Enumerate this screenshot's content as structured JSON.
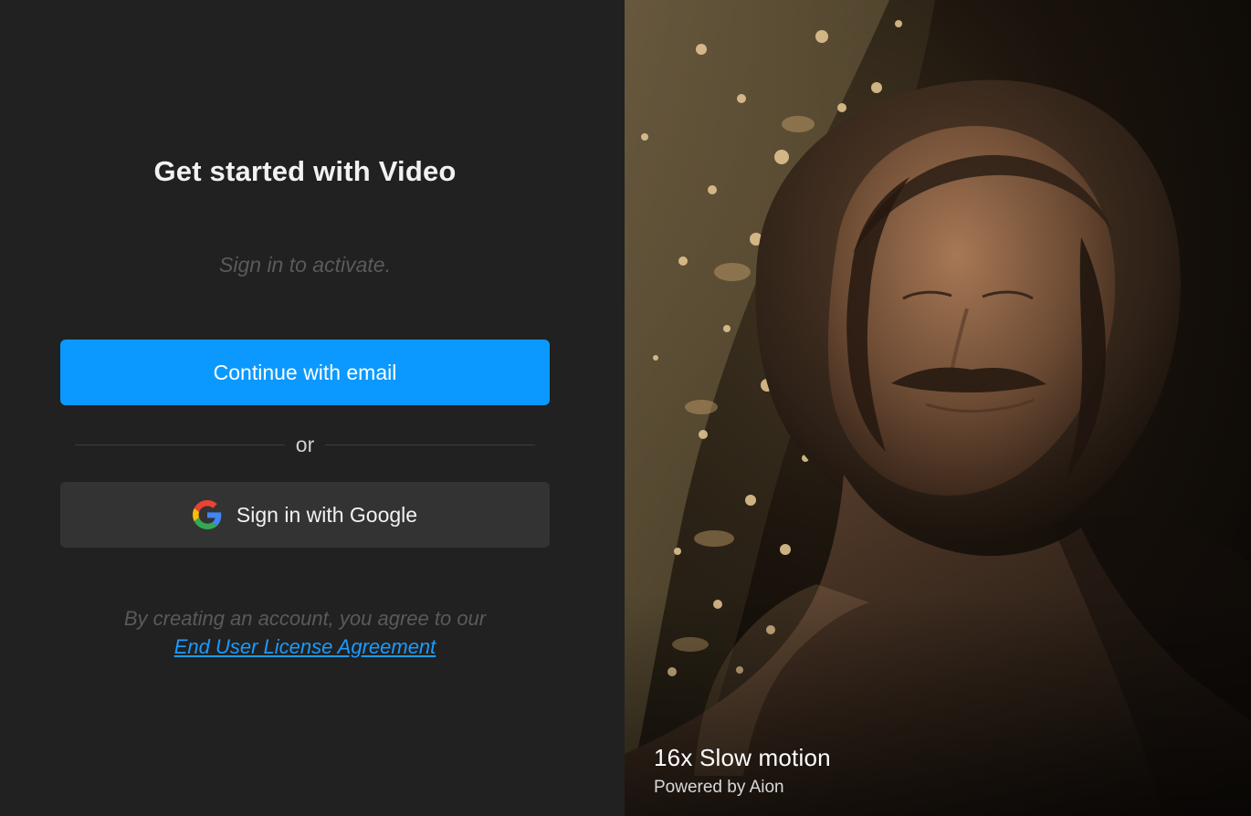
{
  "auth": {
    "title": "Get started with Video",
    "subtitle": "Sign in to activate.",
    "email_button_label": "Continue with email",
    "divider_label": "or",
    "google_button_label": "Sign in with Google",
    "legal_text": "By creating an account, you agree to our",
    "eula_link_label": "End User License Agreement"
  },
  "hero": {
    "caption_title": "16x Slow motion",
    "caption_subtitle": "Powered by Aion"
  },
  "colors": {
    "background": "#212121",
    "primary_button": "#0b99ff",
    "secondary_button": "#333333",
    "link": "#1a9bff"
  },
  "icons": {
    "google_button_icon": "google-icon"
  }
}
